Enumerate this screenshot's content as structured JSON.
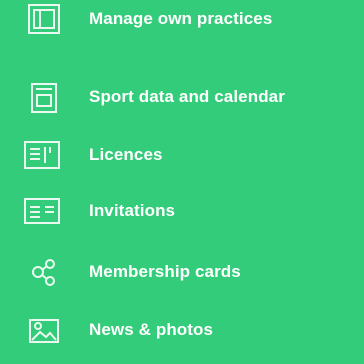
{
  "menu": {
    "items": [
      {
        "label": "Manage own practices",
        "icon": "practices-icon"
      },
      {
        "label": "Sport data and calendar",
        "icon": "calendar-icon"
      },
      {
        "label": "Licences",
        "icon": "licence-card-icon"
      },
      {
        "label": "Invitations",
        "icon": "invitation-icon"
      },
      {
        "label": "Membership cards",
        "icon": "membership-cards-icon"
      },
      {
        "label": "News & photos",
        "icon": "news-photos-icon"
      }
    ]
  },
  "colors": {
    "background": "#33CC7A",
    "text": "#FFFFFF",
    "icon": "#EAF9F0"
  }
}
